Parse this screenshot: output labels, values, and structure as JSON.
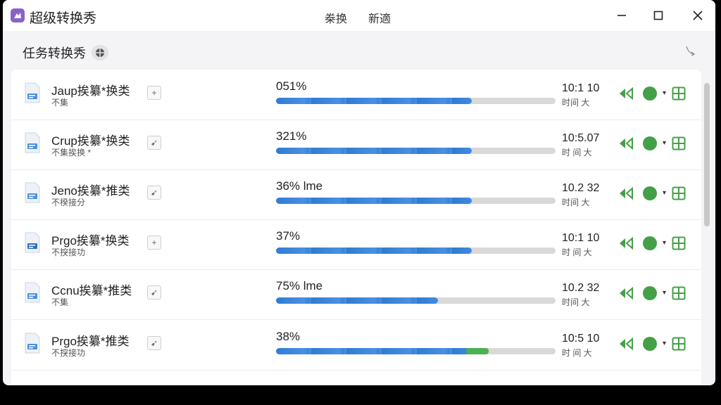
{
  "app": {
    "title": "超级转换秀",
    "icon": "app-logo-icon"
  },
  "menu": [
    {
      "label": "桊换"
    },
    {
      "label": "新適"
    }
  ],
  "window_controls": {
    "minimize": "—",
    "maximize": "☐",
    "close": "✕"
  },
  "header": {
    "title": "任务转换秀",
    "badge": "⊕"
  },
  "colors": {
    "accent": "#4a90e2",
    "green": "#43a047"
  },
  "tasks": [
    {
      "name": "Jaup挨纂*换类",
      "sub": "不集",
      "action": "+",
      "percent": "051%",
      "progress": 0.7,
      "time": "10:1 10",
      "time_sub": "时间 大"
    },
    {
      "name": "Crup挨纂*换类",
      "sub": "不集挨换 *",
      "action": "➹",
      "percent": "321%",
      "progress": 0.7,
      "time": "10:5.07",
      "time_sub": "时 间 大"
    },
    {
      "name": "Jeno挨纂*推类",
      "sub": "不楑接分",
      "action": "➹",
      "percent": "36% lme",
      "progress": 0.7,
      "time": "10.2 32",
      "time_sub": "时间 大"
    },
    {
      "name": "Prgo挨纂*换类",
      "sub": "不揬接功",
      "action": "+",
      "percent": "37%",
      "progress": 0.7,
      "time": "10:1 10",
      "time_sub": "时 间 大"
    },
    {
      "name": "Ccnu挨纂*推类",
      "sub": "不集",
      "action": "➹",
      "percent": "75% lme",
      "progress": 0.58,
      "time": "10.2 32",
      "time_sub": "时间 大"
    },
    {
      "name": "Prgo挨纂*推类",
      "sub": "不揬接功",
      "action": "➹",
      "percent": "38%",
      "progress": 0.76,
      "time": "10:5 10",
      "time_sub": "时 间 大"
    }
  ]
}
